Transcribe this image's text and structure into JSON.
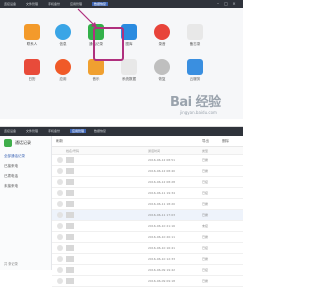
{
  "top": {
    "tabs": [
      "连接设备",
      "文件管理",
      "手机备份",
      "应用管理",
      "数据恢复"
    ],
    "active_tab": 4,
    "window_controls": [
      "–",
      "□",
      "×"
    ]
  },
  "apps": [
    {
      "name": "contacts",
      "label": "联系人",
      "color": "#f39a2b",
      "icon": "contacts-icon"
    },
    {
      "name": "messages",
      "label": "信息",
      "color": "#3aa5e6",
      "icon": "message-icon",
      "round": true
    },
    {
      "name": "call-log",
      "label": "通话记录",
      "color": "#33b04a",
      "icon": "phone-icon"
    },
    {
      "name": "gallery",
      "label": "图库",
      "color": "#2a8be0",
      "icon": "gallery-icon"
    },
    {
      "name": "recorder",
      "label": "录音",
      "color": "#e8443a",
      "icon": "record-icon",
      "round": true
    },
    {
      "name": "notes",
      "label": "备忘录",
      "color": "#e8e8e8",
      "icon": "notes-icon"
    },
    {
      "name": "calendar",
      "label": "日历",
      "color": "#e84b3a",
      "icon": "calendar-icon"
    },
    {
      "name": "apps",
      "label": "应用",
      "color": "#f05a28",
      "icon": "apps-icon",
      "round": true
    },
    {
      "name": "music",
      "label": "音乐",
      "color": "#f0a030",
      "icon": "music-icon"
    },
    {
      "name": "system-data",
      "label": "系统数据",
      "color": "#e8e8e8",
      "icon": "database-icon"
    },
    {
      "name": "restore",
      "label": "恢复",
      "color": "#bfbfbf",
      "icon": "restore-icon",
      "round": true
    },
    {
      "name": "cloud",
      "label": "云服务",
      "color": "#3a8fe0",
      "icon": "cloud-icon"
    }
  ],
  "watermark": {
    "main": "Bai 经验",
    "url": "jingyan.baidu.com"
  },
  "lower": {
    "tabs": [
      "连接设备",
      "文件管理",
      "手机备份",
      "应用管理",
      "数据恢复"
    ],
    "active_tab": 3,
    "sidebar": {
      "title": "通话记录",
      "items": [
        "全部通话记录",
        "已接来电",
        "已拨电话",
        "未接来电"
      ],
      "footer": "共 条记录"
    },
    "toolbar": {
      "refresh": "刷新",
      "export": "导出",
      "delete": "删除"
    },
    "columns": [
      "姓名/号码",
      "通话时间",
      "类型"
    ],
    "rows": [
      {
        "time": "2016-06-12 08:51",
        "type": "已拨",
        "hl": false
      },
      {
        "time": "2016-06-12 08:40",
        "type": "已拨",
        "hl": false
      },
      {
        "time": "2016-06-12 08:28",
        "type": "已接",
        "hl": false
      },
      {
        "time": "2016-06-11 19:34",
        "type": "已接",
        "hl": false
      },
      {
        "time": "2016-06-11 18:20",
        "type": "已拨",
        "hl": false
      },
      {
        "time": "2016-06-11 17:03",
        "type": "已拨",
        "hl": true
      },
      {
        "time": "2016-06-10 21:16",
        "type": "未接",
        "hl": false
      },
      {
        "time": "2016-06-10 20:11",
        "type": "已拨",
        "hl": false
      },
      {
        "time": "2016-06-10 16:41",
        "type": "已接",
        "hl": false
      },
      {
        "time": "2016-06-10 12:33",
        "type": "已拨",
        "hl": false
      },
      {
        "time": "2016-06-09 19:42",
        "type": "已接",
        "hl": false
      },
      {
        "time": "2016-06-09 09:18",
        "type": "已拨",
        "hl": false
      }
    ]
  }
}
